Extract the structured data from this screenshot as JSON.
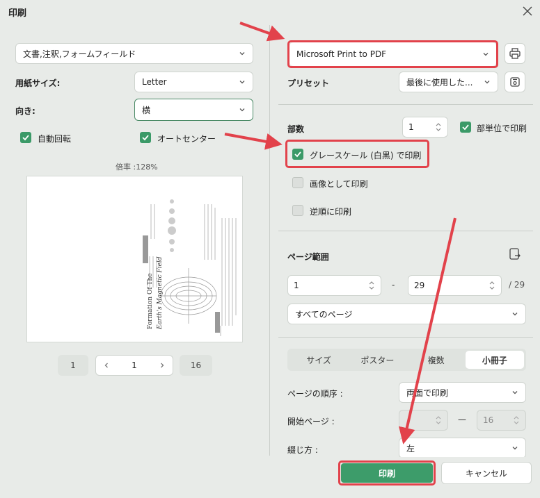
{
  "dialog": {
    "title": "印刷"
  },
  "left": {
    "content_select": "文書,注釈,フォームフィールド",
    "paper_size_label": "用紙サイズ:",
    "paper_size_value": "Letter",
    "orientation_label": "向き:",
    "orientation_value": "横",
    "auto_rotate_label": "自動回転",
    "auto_center_label": "オートセンター",
    "zoom_label": "倍率 :128%",
    "preview": {
      "title_line1": "Formation Of The",
      "title_line2": "Earth's Magnetic Field"
    },
    "pager": {
      "first": "1",
      "current": "1",
      "last": "16"
    }
  },
  "right": {
    "printer_value": "Microsoft Print to PDF",
    "preset_label": "プリセット",
    "preset_value": "最後に使用した...",
    "copies_label": "部数",
    "copies_value": "1",
    "collate_label": "部単位で印刷",
    "grayscale_label": "グレースケール (白黒) で印刷",
    "as_image_label": "画像として印刷",
    "reverse_label": "逆順に印刷",
    "page_range_label": "ページ範囲",
    "range_from": "1",
    "range_dash": "-",
    "range_to": "29",
    "range_total": "/ 29",
    "pages_subset": "すべてのページ",
    "modes": [
      "サイズ",
      "ポスター",
      "複数",
      "小冊子"
    ],
    "active_mode": "小冊子",
    "page_order_label": "ページの順序 :",
    "page_order_value": "両面で印刷",
    "start_page_label": "開始ページ :",
    "start_from": "",
    "start_dash": "—",
    "start_to": "16",
    "binding_label": "綴じ方 :",
    "binding_value": "左"
  },
  "footer": {
    "print_button": "印刷",
    "cancel_button": "キャンセル"
  },
  "colors": {
    "accent": "#3d9c6a",
    "annotation": "#e2424b"
  }
}
